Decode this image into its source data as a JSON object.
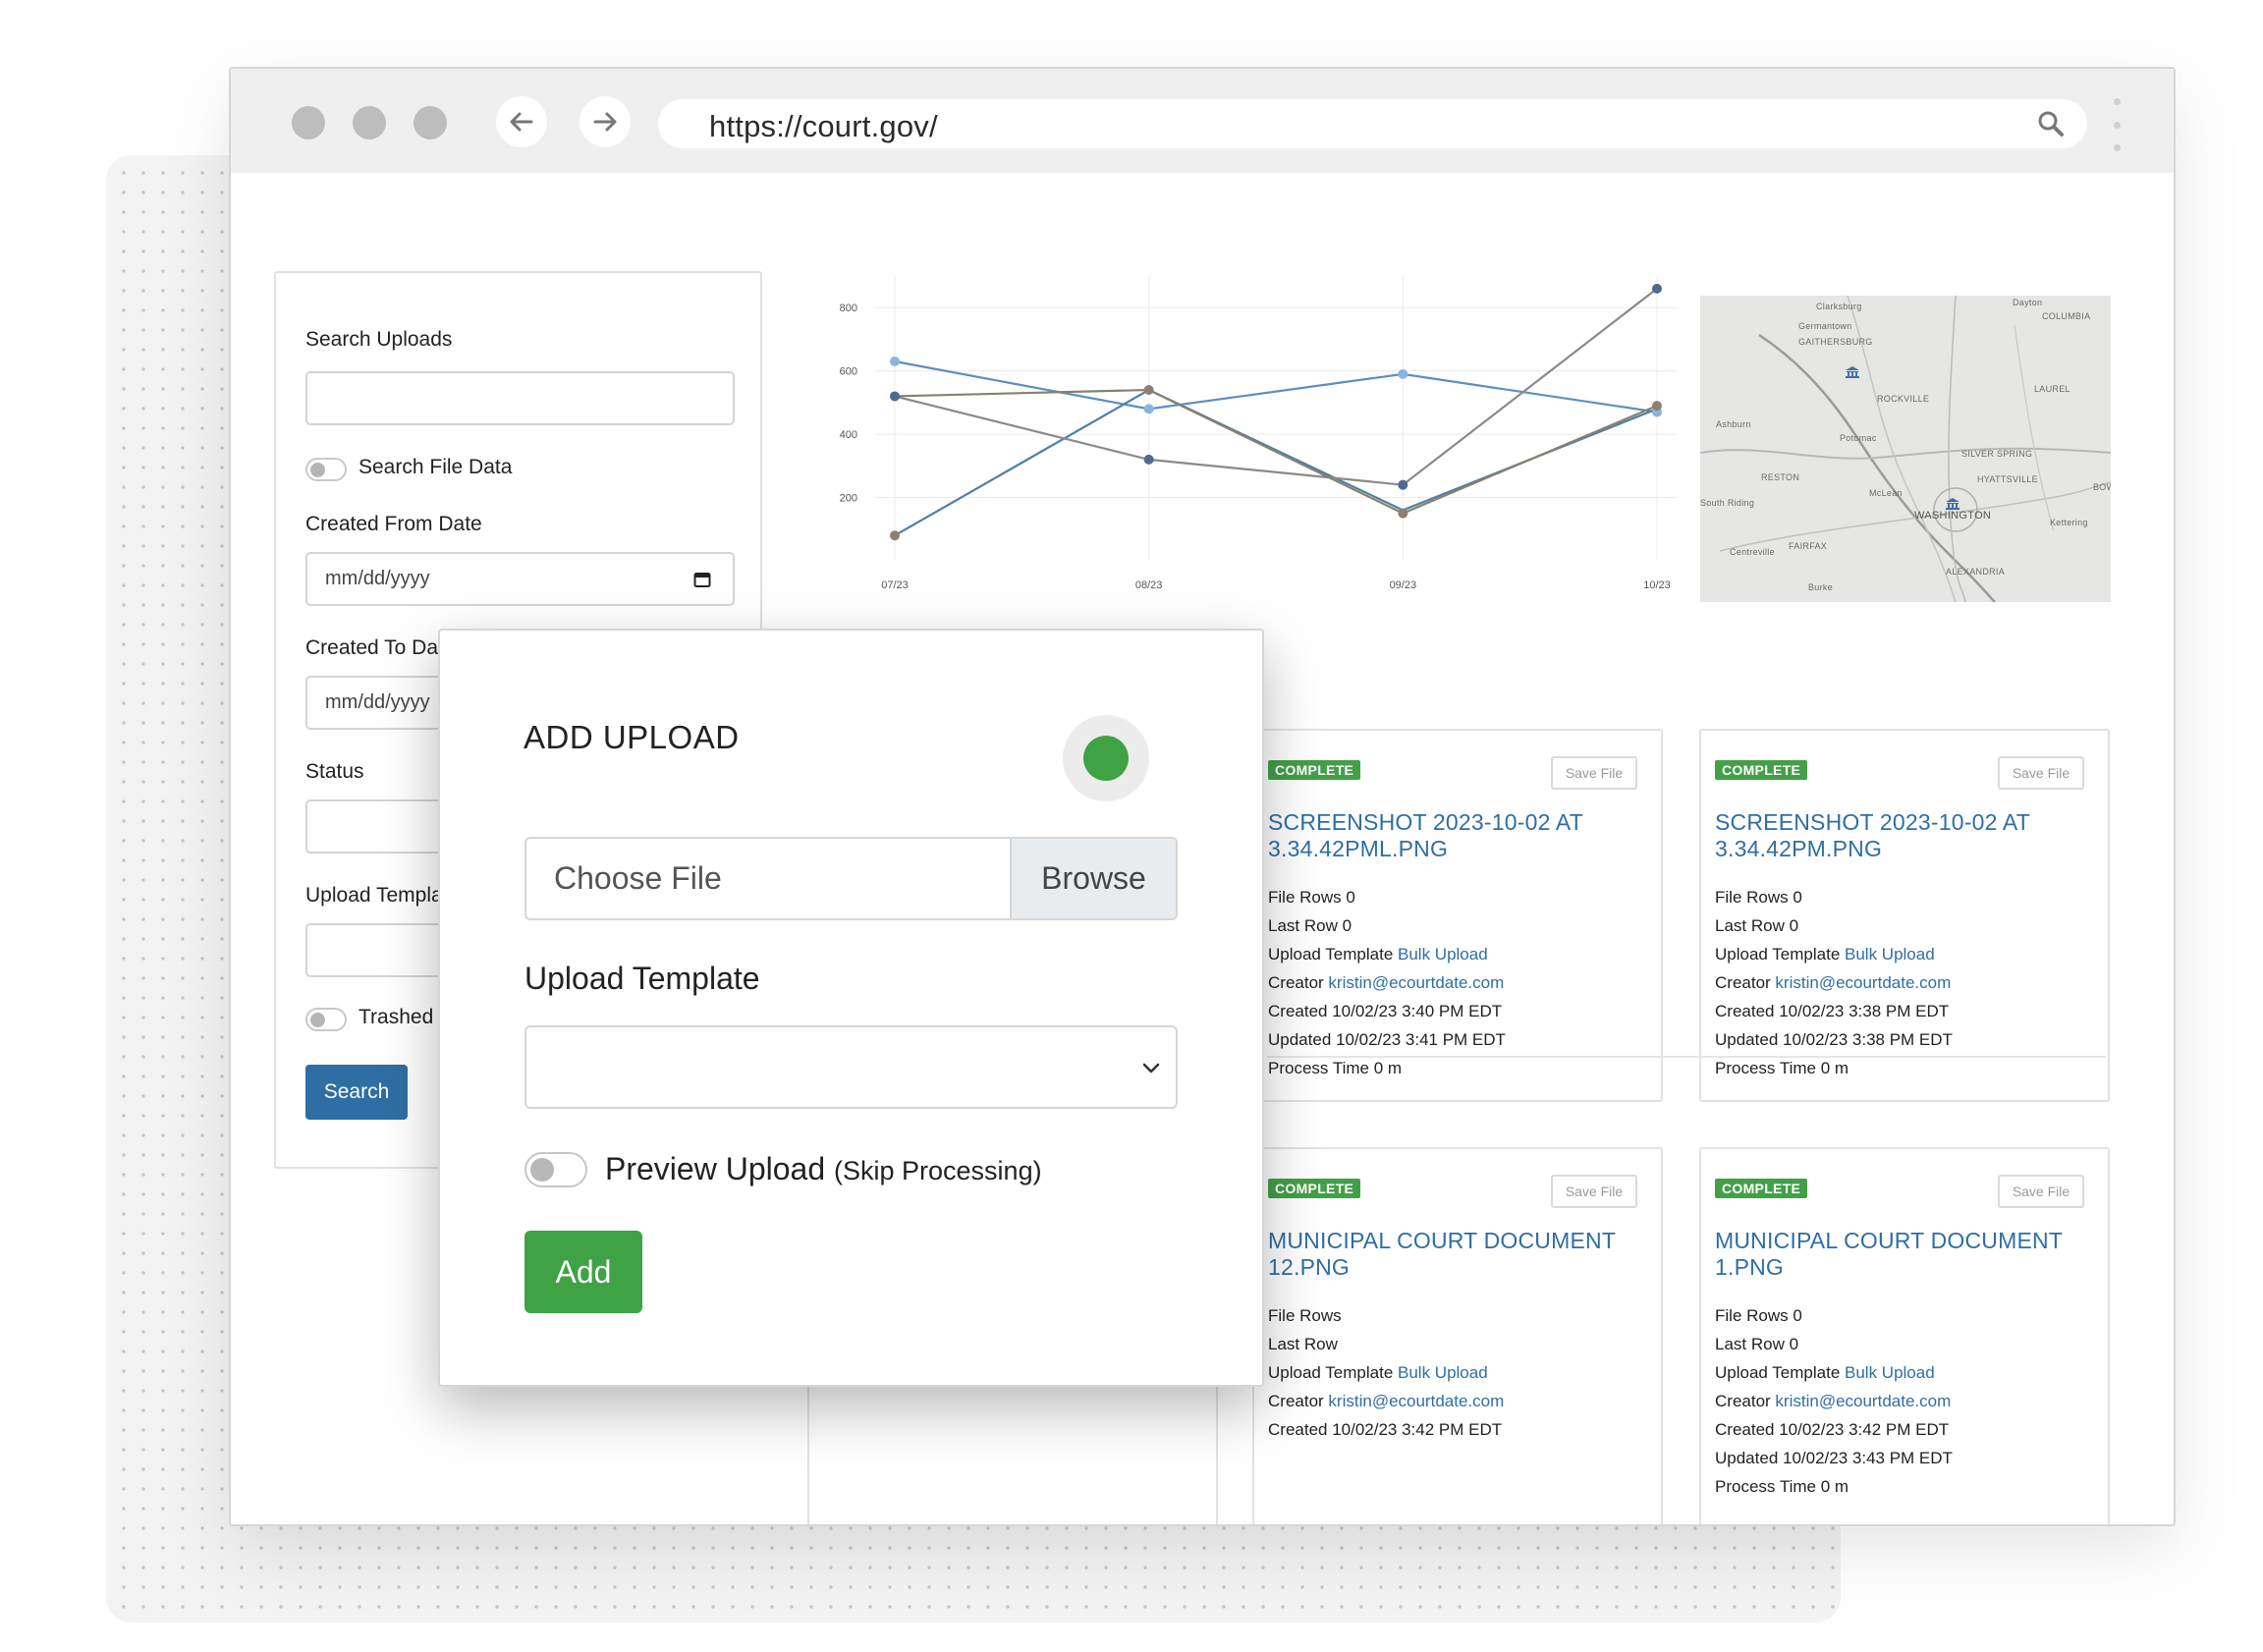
{
  "browser": {
    "url": "https://court.gov/",
    "icons": {
      "back": "arrow-left-icon",
      "forward": "arrow-right-icon",
      "search": "magnifier-icon",
      "menu": "kebab-icon"
    }
  },
  "sidebar": {
    "search_uploads_label": "Search Uploads",
    "search_file_data_label": "Search File Data",
    "created_from_label": "Created From Date",
    "created_from_placeholder": "mm/dd/yyyy",
    "created_to_label": "Created To Date",
    "created_to_placeholder": "mm/dd/yyyy",
    "status_label": "Status",
    "upload_template_label": "Upload Template",
    "trashed_label": "Trashed",
    "search_button": "Search"
  },
  "chart_data": {
    "type": "line",
    "categories": [
      "07/23",
      "08/23",
      "09/23",
      "10/23"
    ],
    "ylim": [
      0,
      900
    ],
    "yticks": [
      200,
      400,
      600,
      800
    ],
    "grid": true,
    "series": [
      {
        "values": [
          630,
          480,
          590,
          470
        ],
        "color": "#5b8ec4"
      },
      {
        "values": [
          80,
          540,
          160,
          480
        ],
        "color": "#4f7fa8"
      },
      {
        "values": [
          520,
          320,
          240,
          860
        ],
        "color": "#8a8a8a"
      },
      {
        "values": [
          520,
          540,
          150,
          490
        ],
        "color": "#888070"
      }
    ],
    "markers": {
      "light": {
        "color": "#8ab4e0",
        "points": [
          [
            0,
            630
          ],
          [
            1,
            480
          ],
          [
            2,
            590
          ],
          [
            3,
            470
          ]
        ]
      },
      "dark": {
        "color": "#4f6a91",
        "points": [
          [
            0,
            520
          ],
          [
            1,
            320
          ],
          [
            2,
            240
          ],
          [
            3,
            860
          ]
        ]
      },
      "brown": {
        "color": "#8d8070",
        "points": [
          [
            0,
            80
          ],
          [
            1,
            540
          ],
          [
            2,
            150
          ],
          [
            3,
            490
          ]
        ]
      }
    }
  },
  "map": {
    "places": [
      "Clarksburg",
      "Germantown",
      "GAITHERSBURG",
      "ROCKVILLE",
      "Potomac",
      "SILVER SPRING",
      "LAUREL",
      "COLUMBIA",
      "Dayton",
      "RESTON",
      "McLean",
      "HYATTSVILLE",
      "WASHINGTON",
      "FAIRFAX",
      "Centreville",
      "ALEXANDRIA",
      "Burke",
      "Ashburn",
      "South Riding",
      "Kettering",
      "BOW"
    ]
  },
  "cards": [
    {
      "status": "COMPLETE",
      "save_label": "Save File",
      "title": "SCREENSHOT 2023-10-02 AT 3.34.42PML.PNG",
      "file_rows": "File Rows 0",
      "last_row": "Last Row 0",
      "template_prefix": "Upload Template ",
      "template_link": "Bulk Upload",
      "creator_prefix": "Creator ",
      "creator_link": "kristin@ecourtdate.com",
      "created": "Created 10/02/23 3:40 PM EDT",
      "updated": "Updated 10/02/23 3:41 PM EDT",
      "process_time": "Process Time 0 m"
    },
    {
      "status": "COMPLETE",
      "save_label": "Save File",
      "title": "SCREENSHOT 2023-10-02 AT 3.34.42PM.PNG",
      "file_rows": "File Rows 0",
      "last_row": "Last Row 0",
      "template_prefix": "Upload Template ",
      "template_link": "Bulk Upload",
      "creator_prefix": "Creator ",
      "creator_link": "kristin@ecourtdate.com",
      "created": "Created 10/02/23 3:38 PM EDT",
      "updated": "Updated 10/02/23 3:38 PM EDT",
      "process_time": "Process Time 0 m"
    },
    {
      "status": "COMPLETE",
      "save_label": "Save File",
      "title": "MUNICIPAL COURT DOCUMENT 12.PNG",
      "file_rows": "File Rows",
      "last_row": "Last Row",
      "template_prefix": "Upload Template ",
      "template_link": "Bulk Upload",
      "creator_prefix": "Creator ",
      "creator_link": "kristin@ecourtdate.com",
      "created": "Created 10/02/23 3:42 PM EDT"
    },
    {
      "status": "COMPLETE",
      "save_label": "Save File",
      "title": "MUNICIPAL COURT DOCUMENT 1.PNG",
      "file_rows": "File Rows 0",
      "last_row": "Last Row 0",
      "template_prefix": "Upload Template ",
      "template_link": "Bulk Upload",
      "creator_prefix": "Creator ",
      "creator_link": "kristin@ecourtdate.com",
      "created": "Created 10/02/23 3:42 PM EDT",
      "updated": "Updated 10/02/23 3:43 PM EDT",
      "process_time": "Process Time 0 m"
    }
  ],
  "modal": {
    "title": "ADD UPLOAD",
    "status_color": "#3fa245",
    "file_placeholder": "Choose File",
    "browse_label": "Browse",
    "template_label": "Upload Template",
    "preview_label": "Preview Upload",
    "preview_sub": "(Skip Processing)",
    "add_label": "Add"
  },
  "colors": {
    "primary": "#2f6ea5",
    "success": "#43a047"
  }
}
